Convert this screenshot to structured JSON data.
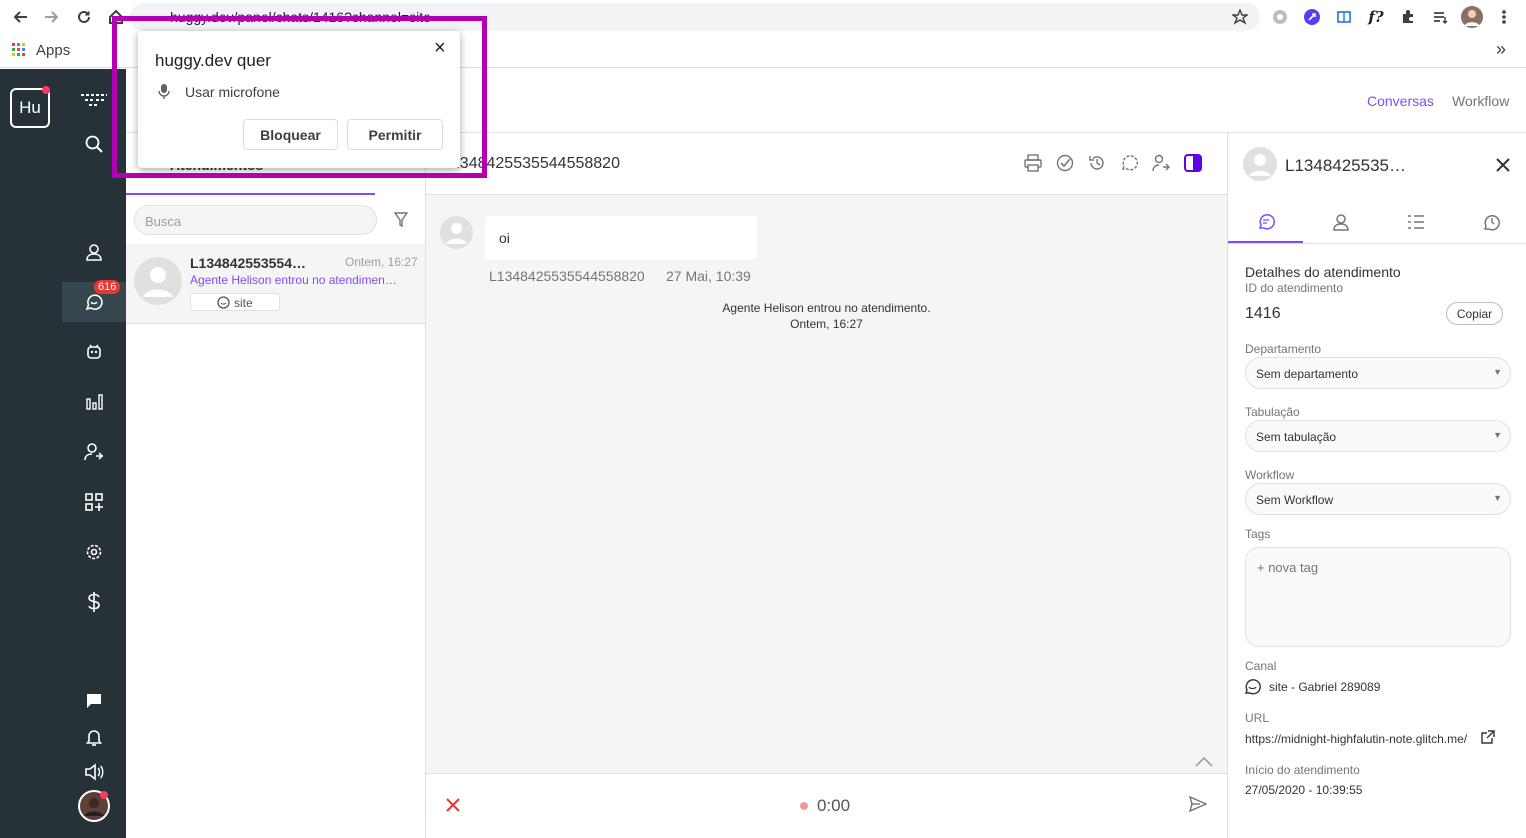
{
  "browser": {
    "url_text": "huggy.dev/panel/chats/1416?channel=site",
    "bookmarks_apps": "Apps",
    "more_bookmarks": "»"
  },
  "popup": {
    "title": "huggy.dev quer",
    "permission": "Usar microfone",
    "block_label": "Bloquear",
    "allow_label": "Permitir",
    "close": "×"
  },
  "sidebar": {
    "logo": "Hu",
    "badge_count": "616"
  },
  "header": {
    "links": [
      "Conversas",
      "Workflow"
    ]
  },
  "list": {
    "tab_label": "Atendimentos",
    "search_placeholder": "Busca",
    "item": {
      "name": "L134842553554…",
      "time": "Ontem, 16:27",
      "preview": "Agente Helison entrou no atendimen…",
      "channel": "site"
    }
  },
  "chat": {
    "title": "L1348425535544558820",
    "message": {
      "text": "oi",
      "sender": "L1348425535544558820",
      "time": "27 Mai, 10:39"
    },
    "system_message": "Agente Helison entrou no atendimento.",
    "system_time": "Ontem, 16:27",
    "recording_time": "0:00"
  },
  "detail": {
    "name": "L1348425535…",
    "section_title": "Detalhes do atendimento",
    "id_label": "ID do atendimento",
    "id_value": "1416",
    "copy_label": "Copiar",
    "department_label": "Departamento",
    "department_value": "Sem departamento",
    "tabulation_label": "Tabulação",
    "tabulation_value": "Sem tabulação",
    "workflow_label": "Workflow",
    "workflow_value": "Sem Workflow",
    "tags_label": "Tags",
    "new_tag": "+ nova tag",
    "channel_label": "Canal",
    "channel_value": "site - Gabriel 289089",
    "url_label": "URL",
    "url_value": "https://midnight-highfalutin-note.glitch.me/",
    "start_label": "Início do atendimento",
    "start_value": "27/05/2020 - 10:39:55"
  },
  "colors": {
    "accent": "#7c4dff",
    "sidebar_bg": "#263238",
    "highlight": "#b300b3",
    "badge": "#e53935"
  }
}
